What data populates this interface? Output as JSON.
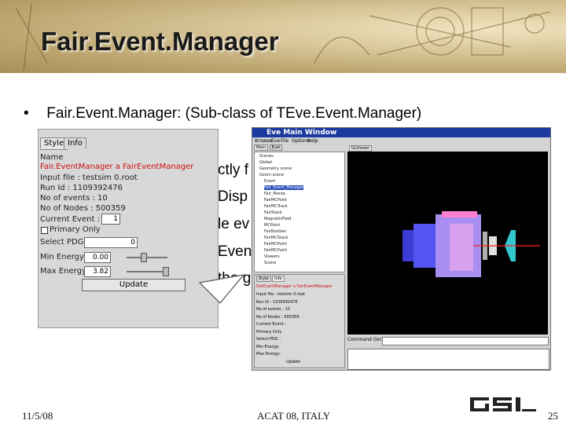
{
  "slide": {
    "title": "Fair.Event.Manager",
    "bullet": "•",
    "bullet_text": "Fair.Event.Manager: (Sub-class of TEve.Event.Manager)",
    "partial_lines": [
      "ctly f",
      "Disp",
      "le ev",
      "Even",
      "the g"
    ]
  },
  "info_panel": {
    "tabs": [
      "Style",
      "Info"
    ],
    "name_label": "Name",
    "name_value": "Fair.EventManager a FairEventManager",
    "input_file": "Input file : testsim 0.root",
    "run_id": "Run Id : 1109392476",
    "no_events": "No of events : 10",
    "no_nodes": "No of Nodes : 500359",
    "current_event_label": "Current Event :",
    "current_event_value": "1",
    "primary_only": "Primary Only",
    "select_pdg_label": "Select PDG :",
    "select_pdg_value": "0",
    "min_energy_label": "Min Energy:",
    "min_energy_value": "0.00",
    "max_energy_label": "Max Energy:",
    "max_energy_value": "3.82",
    "update_label": "Update"
  },
  "eve_window": {
    "title": "Eve Main Window",
    "menu": [
      "Browse",
      "Eve",
      "File",
      "Options",
      "Help"
    ],
    "left_tabs": [
      "Main",
      "Eval"
    ],
    "viewer_tab": "GLViewer",
    "tree_items": [
      "Scenes",
      "Global",
      "Geometry scene",
      "Geom scene",
      "Event",
      "Fair_Event_Manager",
      "Fair_Monte",
      "FairMCPoint",
      "FairMCTrack",
      "FairStack",
      "MagneticField",
      "MCPoint",
      "FairBoxGen",
      "FairMCStack",
      "FairMCPoint",
      "FairMCPoint",
      "Viewers",
      "Scene"
    ],
    "selected_item": "Fair_Event_Manager",
    "panel_tabs": [
      "Style",
      "Info"
    ],
    "panel_title": "FairEventManager a FairEventManager",
    "panel_lines": [
      "Input file : testsim 0.root",
      "Run Id : 1109392476",
      "No of events : 10",
      "No of Nodes : 500359",
      "Current Event :",
      "Primary Only",
      "Select PDG :",
      "Min Energy:",
      "Max Energy:",
      "Update"
    ],
    "command_label": "Command (local):"
  },
  "footer": {
    "date": "11/5/08",
    "center": "ACAT 08, ITALY",
    "page": "25"
  },
  "logo_text": "GSI"
}
